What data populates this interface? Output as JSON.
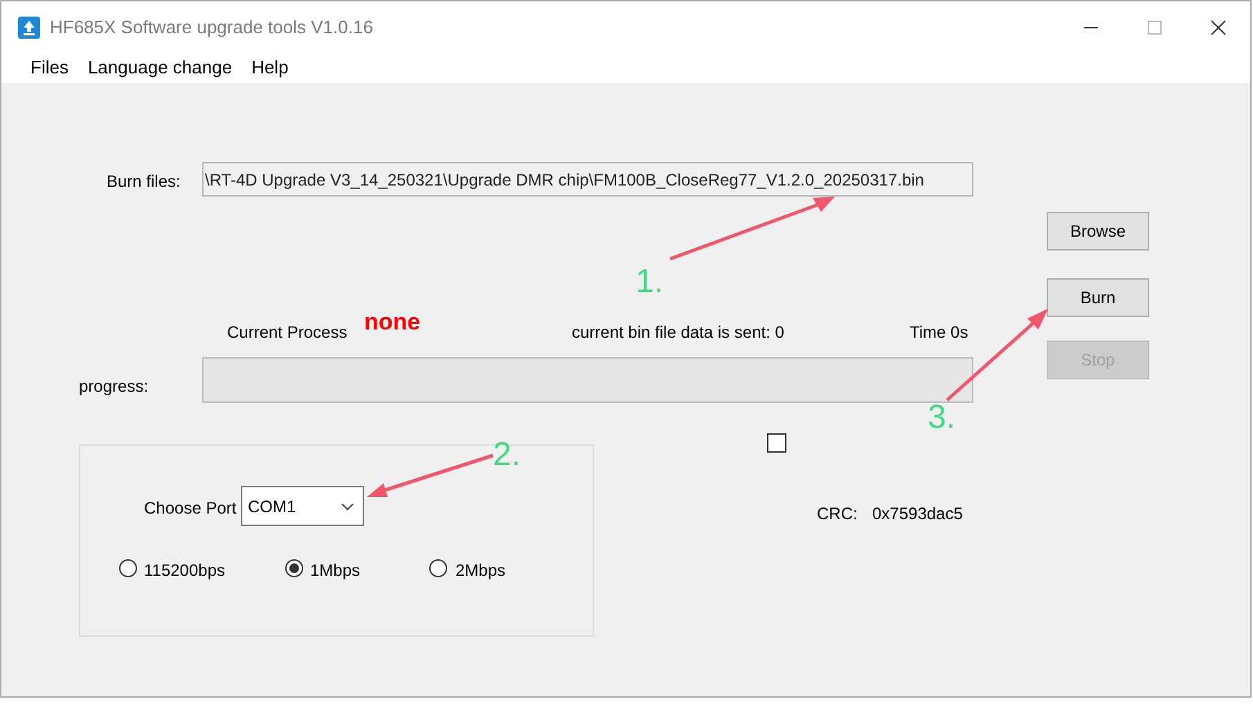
{
  "window": {
    "title": "HF685X Software upgrade tools V1.0.16"
  },
  "menu": [
    "Files",
    "Language change",
    "Help"
  ],
  "burn_files": {
    "label": "Burn files:",
    "value": "\\RT-4D Upgrade V3_14_250321\\Upgrade DMR chip\\FM100B_CloseReg77_V1.2.0_20250317.bin"
  },
  "buttons": [
    {
      "label": "Browse",
      "disabled": false
    },
    {
      "label": "Burn",
      "disabled": false
    },
    {
      "label": "Stop",
      "disabled": true
    }
  ],
  "status": {
    "process_label": "Current Process",
    "process_value": "none",
    "sent": "current bin file data is sent: 0",
    "time": "Time 0s"
  },
  "progress": {
    "label": "progress:",
    "level": 0
  },
  "port": {
    "label": "Choose Port",
    "value": "COM1"
  },
  "baud_rates": [
    {
      "label": "115200bps",
      "selected": false
    },
    {
      "label": "1Mbps",
      "selected": true
    },
    {
      "label": "2Mbps",
      "selected": false
    }
  ],
  "checkbox": {
    "checked": false
  },
  "crc": {
    "label": "CRC:",
    "value": "0x7593dac5"
  },
  "annotations": [
    {
      "label": "1."
    },
    {
      "label": "2."
    },
    {
      "label": "3."
    }
  ]
}
